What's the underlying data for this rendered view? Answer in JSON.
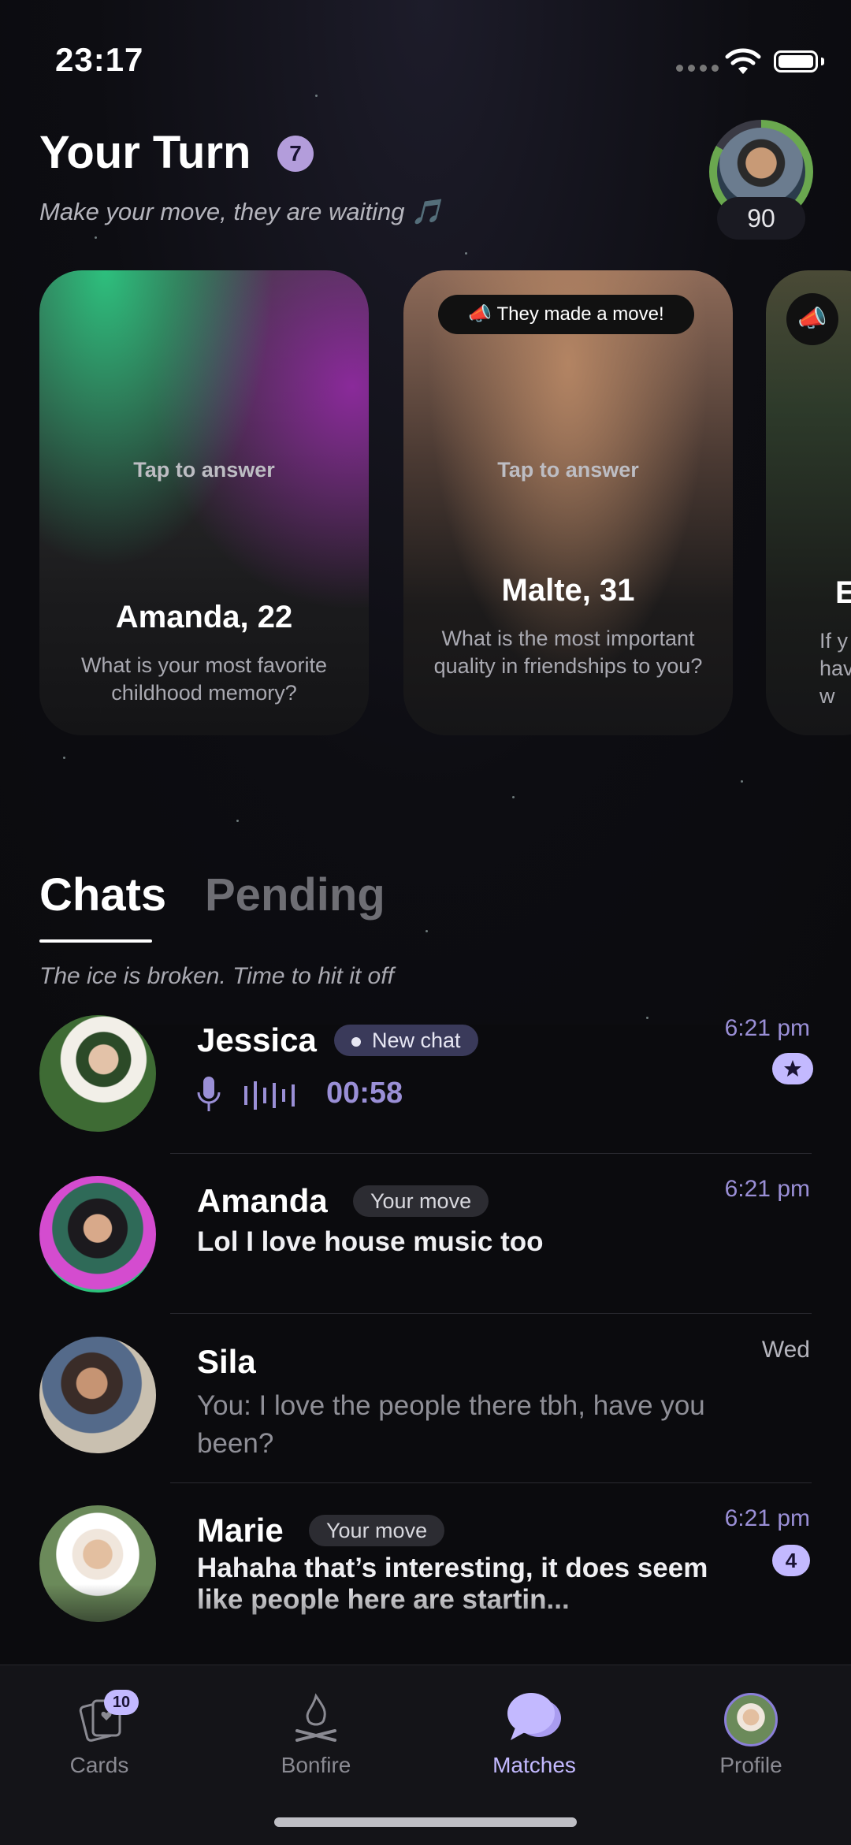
{
  "status_bar": {
    "time": "23:17"
  },
  "header": {
    "title": "Your Turn",
    "badge_count": "7",
    "subtitle": "Make your move, they are waiting 🎵",
    "score": "90"
  },
  "cards": [
    {
      "cta": "Tap to answer",
      "name": "Amanda, 22",
      "question": "What is your most favorite childhood memory?"
    },
    {
      "tag": "📣 They made a move!",
      "cta": "Tap to answer",
      "name": "Malte, 31",
      "question": "What is the most important quality in friendships to you?"
    },
    {
      "name": "E",
      "question": "If y\nhav\nw"
    }
  ],
  "tabs": {
    "chats": "Chats",
    "pending": "Pending"
  },
  "section_caption": "The ice is broken. Time to hit it off",
  "chats": [
    {
      "name": "Jessica",
      "tag": "New chat",
      "time": "6:21 pm",
      "voice_duration": "00:58"
    },
    {
      "name": "Amanda",
      "tag": "Your move",
      "time": "6:21 pm",
      "message": "Lol I love house music too"
    },
    {
      "name": "Sila",
      "time": "Wed",
      "message": "You: I love the people there tbh, have you been?"
    },
    {
      "name": "Marie",
      "tag": "Your move",
      "time": "6:21 pm",
      "message": "Hahaha that’s interesting, it does seem like people here are startin...",
      "unread": "4"
    }
  ],
  "tab_bar": {
    "items": [
      {
        "label": "Cards",
        "badge": "10"
      },
      {
        "label": "Bonfire"
      },
      {
        "label": "Matches",
        "active": true
      },
      {
        "label": "Profile"
      }
    ]
  },
  "colors": {
    "accent": "#c3b9ff",
    "timestamp_unread": "#9a8fd6",
    "background": "#0b0b0e"
  }
}
